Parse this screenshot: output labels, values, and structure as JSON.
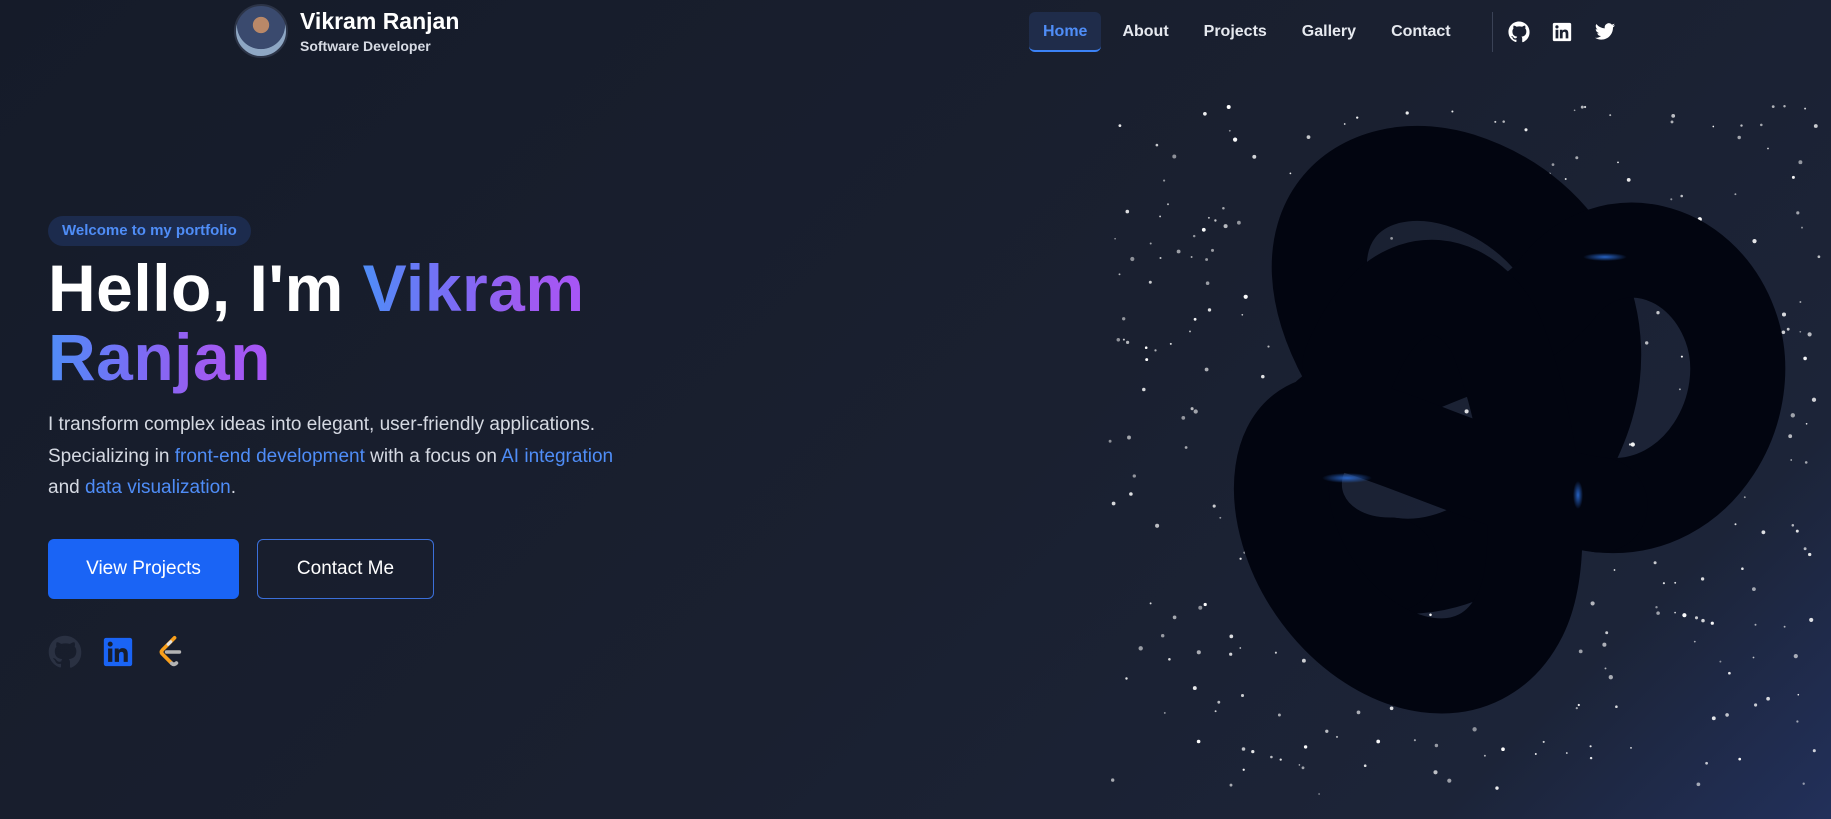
{
  "header": {
    "name": "Vikram Ranjan",
    "role": "Software Developer",
    "avatar_icon": "profile-photo",
    "nav": [
      {
        "label": "Home",
        "active": true
      },
      {
        "label": "About",
        "active": false
      },
      {
        "label": "Projects",
        "active": false
      },
      {
        "label": "Gallery",
        "active": false
      },
      {
        "label": "Contact",
        "active": false
      }
    ],
    "social_icons": [
      "github-icon",
      "linkedin-icon",
      "twitter-icon"
    ]
  },
  "hero": {
    "badge": "Welcome to my portfolio",
    "title_prefix": "Hello, I'm ",
    "title_name_1": "Vikram",
    "title_name_2": "Ranjan",
    "description": {
      "part1": "I transform complex ideas into elegant, user-friendly applications. Specializing in ",
      "hl1": "front-end development",
      "part2": " with a focus on ",
      "hl2": "AI integration",
      "part3": " and ",
      "hl3": "data visualization",
      "part4": "."
    },
    "buttons": {
      "primary": "View Projects",
      "secondary": "Contact Me"
    },
    "social_icons": [
      "github-icon",
      "linkedin-icon",
      "leetcode-icon"
    ]
  },
  "colors": {
    "accent": "#4f8df7",
    "primary_button": "#1a64f5",
    "gradient_end": "#a855f7",
    "background": "#171d2b",
    "knot": "#020510"
  },
  "scene": {
    "object": "torus-knot",
    "background_effect": "starfield"
  }
}
